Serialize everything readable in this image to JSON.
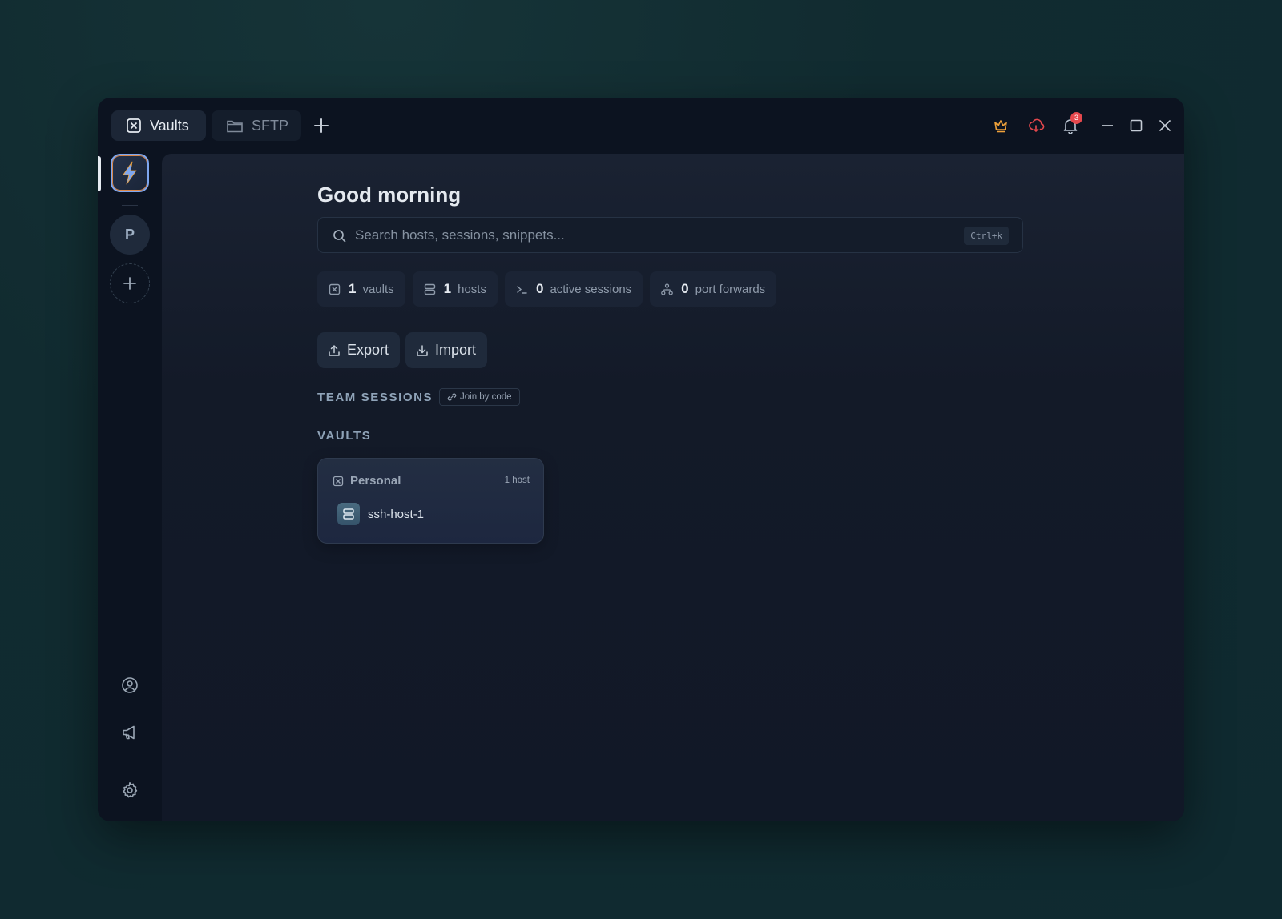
{
  "tabs": [
    {
      "label": "Vaults",
      "icon": "vault-icon",
      "active": true
    },
    {
      "label": "SFTP",
      "icon": "folder-icon",
      "active": false
    }
  ],
  "titlebar": {
    "notification_count": "3",
    "icons": [
      "crown-icon",
      "cloud-sync-icon",
      "bell-icon",
      "minimize-icon",
      "maximize-icon",
      "close-icon"
    ],
    "colors": {
      "crown": "#f0a23a",
      "cloud": "#e5484d",
      "badge": "#e5484d"
    }
  },
  "rail": {
    "avatar_letter": "P",
    "bottom_icons": [
      "user-circle-icon",
      "megaphone-icon",
      "gear-icon"
    ]
  },
  "main": {
    "greeting": "Good morning",
    "search": {
      "placeholder": "Search hosts, sessions, snippets...",
      "shortcut": "Ctrl+k"
    },
    "stats": [
      {
        "value": "1",
        "label": "vaults",
        "icon": "vault-icon"
      },
      {
        "value": "1",
        "label": "hosts",
        "icon": "server-icon"
      },
      {
        "value": "0",
        "label": "active sessions",
        "icon": "terminal-icon"
      },
      {
        "value": "0",
        "label": "port forwards",
        "icon": "network-icon"
      }
    ],
    "actions": {
      "export": "Export",
      "import": "Import"
    },
    "team_sessions": {
      "title": "TEAM SESSIONS",
      "join_label": "Join by code"
    },
    "vaults_section": {
      "title": "VAULTS",
      "cards": [
        {
          "name": "Personal",
          "count": "1 host",
          "hosts": [
            "ssh-host-1"
          ]
        }
      ]
    }
  }
}
